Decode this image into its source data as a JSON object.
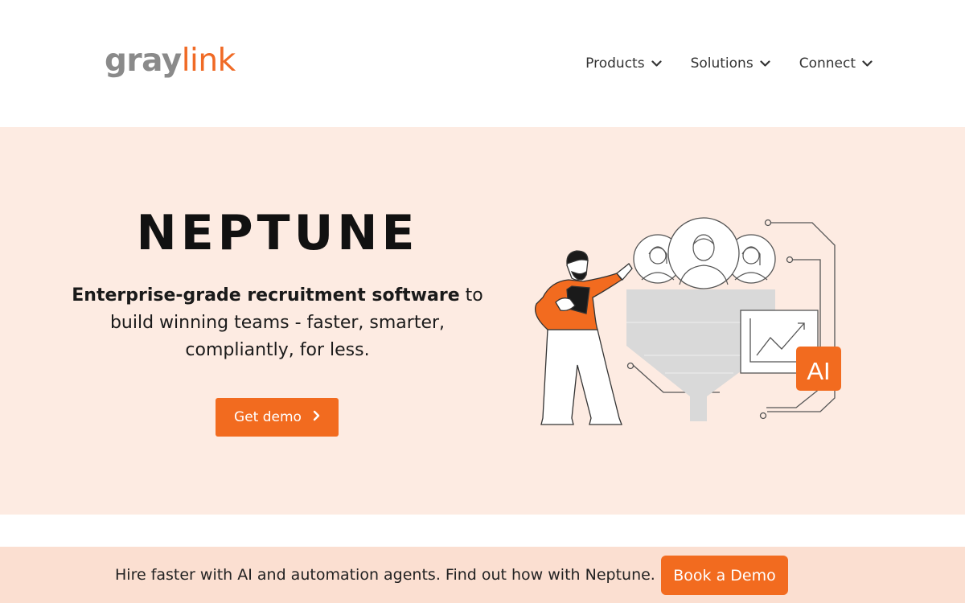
{
  "logo": {
    "part1": "gray",
    "part2": "link"
  },
  "nav": {
    "items": [
      {
        "label": "Products"
      },
      {
        "label": "Solutions"
      },
      {
        "label": "Connect"
      }
    ]
  },
  "hero": {
    "title": "NEPTUNE",
    "subtitle_bold": "Enterprise-grade recruitment software",
    "subtitle_rest": " to build winning teams - faster, smarter, compliantly, for less.",
    "cta_label": "Get demo",
    "illustration_badge": "AI"
  },
  "banner": {
    "text": "Hire faster with AI and automation agents. Find out how with Neptune.",
    "cta_label": "Book a Demo"
  },
  "colors": {
    "accent": "#f26b1f",
    "hero_bg": "#fdebe2",
    "banner_bg": "#fbdfd1",
    "logo_gray": "#8a8a8a"
  },
  "icons": [
    "chevron-down-icon",
    "chevron-right-icon"
  ]
}
